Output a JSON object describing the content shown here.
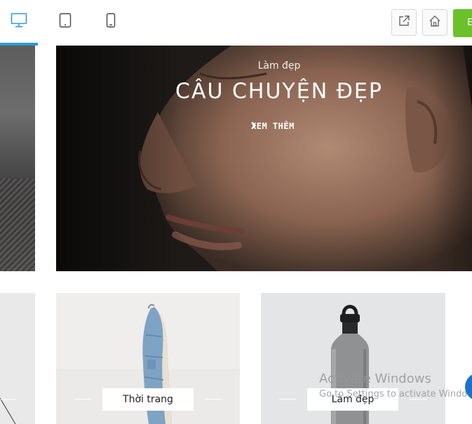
{
  "toolbar": {
    "devices": [
      {
        "name": "desktop",
        "icon": "desktop-icon",
        "active": true
      },
      {
        "name": "tablet",
        "icon": "tablet-icon",
        "active": false
      },
      {
        "name": "mobile",
        "icon": "mobile-icon",
        "active": false
      }
    ],
    "actions": [
      {
        "icon": "external-link-icon"
      },
      {
        "icon": "home-icon"
      }
    ],
    "green_button_label": "E",
    "accent_color": "#2d9bd8",
    "green_color": "#6ac12a"
  },
  "hero": {
    "category": "Làm đẹp",
    "title": "CÂU CHUYỆN ĐẸP",
    "link_label": "XEM THÊM"
  },
  "cards": [
    {
      "label": "Thời trang"
    },
    {
      "label": "Làm đẹp"
    }
  ],
  "watermark": {
    "title": "Activate Windows",
    "subtitle": "Go to Settings to activate Windows."
  }
}
